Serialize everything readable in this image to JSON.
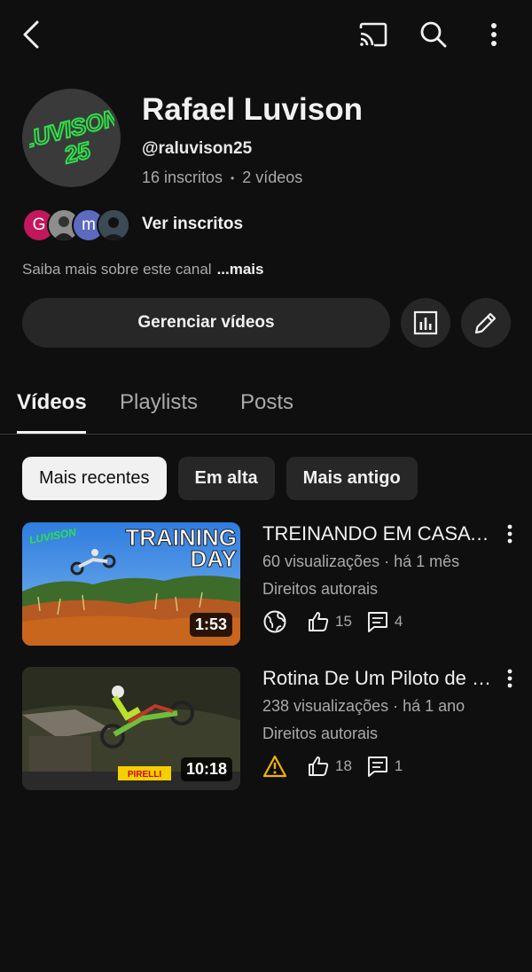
{
  "channel": {
    "logo_text": "LUVISON 25",
    "name": "Rafael Luvison",
    "handle": "@raluvison25",
    "subscribers": "16 inscritos",
    "separator": "•",
    "videos_count": "2 vídeos",
    "subscriber_avatars": [
      {
        "letter": "G",
        "color": "#c2185b"
      },
      {
        "letter": "",
        "color": "#5f6368"
      },
      {
        "letter": "m",
        "color": "#5c6bc0"
      },
      {
        "letter": "",
        "color": "#37474f"
      }
    ],
    "see_subscribers": "Ver inscritos",
    "about": "Saiba mais sobre este canal",
    "about_more": "...mais",
    "manage_videos": "Gerenciar vídeos"
  },
  "tabs": [
    "Vídeos",
    "Playlists",
    "Posts"
  ],
  "active_tab": "Vídeos",
  "chips": [
    "Mais recentes",
    "Em alta",
    "Mais antigo"
  ],
  "selected_chip": "Mais recentes",
  "videos": [
    {
      "thumb_text_1": "TRAINING",
      "thumb_text_2": "DAY",
      "thumb_logo": "LUVISON",
      "duration": "1:53",
      "title": "TREINANDO EM CASA | TRAINING DAY",
      "meta": "60 visualizações · há 1 mês",
      "rights": "Direitos autorais",
      "visibility_icon": "globe-icon",
      "likes": "15",
      "comments": "4"
    },
    {
      "thumb_brand": "PIRELLI",
      "duration": "10:18",
      "title": "Rotina De Um Piloto de Motocross",
      "meta": "238 visualizações · há 1 ano",
      "rights": "Direitos autorais",
      "visibility_icon": "warning-icon",
      "likes": "18",
      "comments": "1"
    }
  ],
  "colors": {
    "background": "#0f0f0f",
    "surface": "#272727",
    "text": "#f1f1f1",
    "secondary_text": "#aaaaaa",
    "logo_green": "#2ee04a",
    "warning": "#f4b400"
  }
}
